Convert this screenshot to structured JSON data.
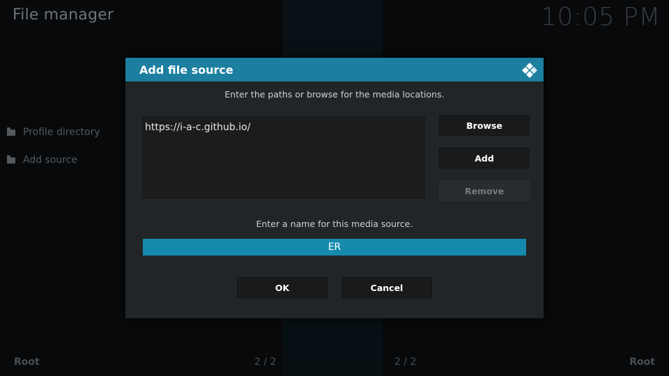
{
  "app": {
    "title": "File manager",
    "clock": "10:05 PM"
  },
  "sidebar": {
    "items": [
      {
        "label": "Profile directory",
        "icon": "folder-icon"
      },
      {
        "label": "Add source",
        "icon": "folder-icon"
      }
    ]
  },
  "footer": {
    "left": "Root",
    "right": "Root",
    "page_left": "2 / 2",
    "page_right": "2 / 2"
  },
  "dialog": {
    "title": "Add file source",
    "icon": "kodi-logo-icon",
    "paths_prompt": "Enter the paths or browse for the media locations.",
    "paths": [
      "https://i-a-c.github.io/"
    ],
    "browse_label": "Browse",
    "add_label": "Add",
    "remove_label": "Remove",
    "name_prompt": "Enter a name for this media source.",
    "name_value": "ER",
    "ok_label": "OK",
    "cancel_label": "Cancel"
  },
  "colors": {
    "accent": "#1c7fa0",
    "input_focus": "#168aad",
    "dialog_bg": "#222527"
  }
}
